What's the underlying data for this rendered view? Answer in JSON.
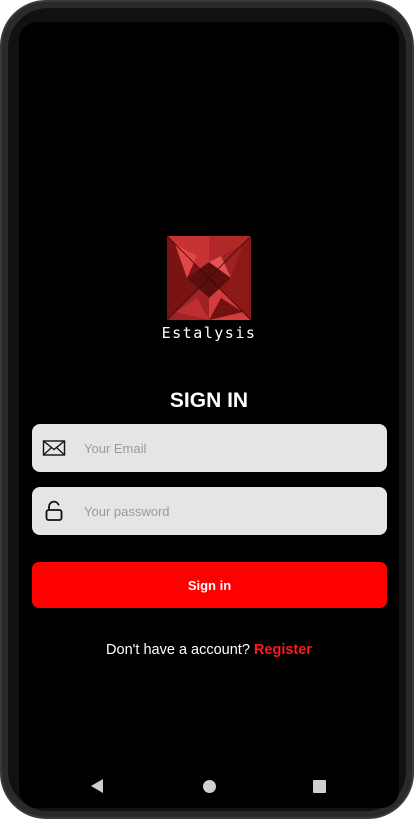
{
  "brand": {
    "name": "Estalysis",
    "logo_icon": "faceted-red-crystal-logo"
  },
  "signin": {
    "title": "SIGN IN",
    "email_placeholder": "Your Email",
    "email_value": "",
    "email_icon": "envelope-icon",
    "password_placeholder": "Your password",
    "password_value": "",
    "password_icon": "unlock-icon",
    "button_label": "Sign in"
  },
  "register": {
    "prompt": "Don't have a account?",
    "link_label": "Register"
  },
  "navigation_bar": {
    "back_icon": "triangle-back-icon",
    "home_icon": "circle-home-icon",
    "recents_icon": "square-recents-icon"
  },
  "colors": {
    "accent": "#ff0000",
    "link": "#ff1a1a",
    "background": "#000000",
    "field_background": "#e5e5e5",
    "text": "#ffffff"
  }
}
